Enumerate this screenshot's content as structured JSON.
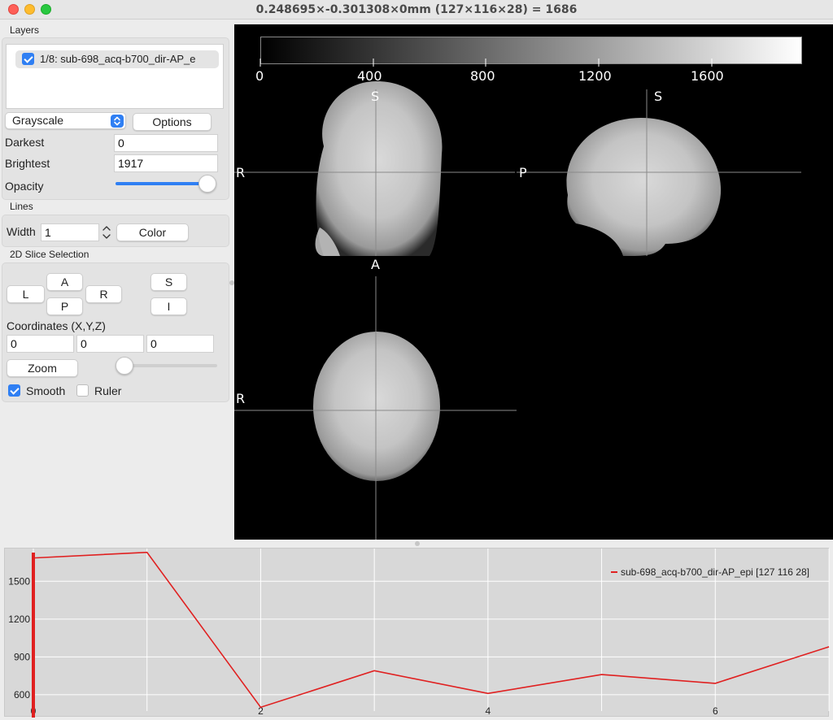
{
  "window": {
    "title": "0.248695×-0.301308×0mm (127×116×28) =  1686"
  },
  "layers": {
    "section_label": "Layers",
    "items": [
      {
        "label": "1/8: sub-698_acq-b700_dir-AP_e",
        "checked": true
      }
    ],
    "colormap": "Grayscale",
    "options_label": "Options",
    "darkest_label": "Darkest",
    "darkest_value": "0",
    "brightest_label": "Brightest",
    "brightest_value": "1917",
    "opacity_label": "Opacity",
    "opacity_level": 1.0
  },
  "lines": {
    "section_label": "Lines",
    "width_label": "Width",
    "width_value": "1",
    "color_label": "Color"
  },
  "slice": {
    "section_label": "2D Slice Selection",
    "buttons": {
      "L": "L",
      "A": "A",
      "R": "R",
      "P": "P",
      "S": "S",
      "I": "I"
    },
    "coordinates_label": "Coordinates (X,Y,Z)",
    "x": "0",
    "y": "0",
    "z": "0",
    "zoom_label": "Zoom",
    "zoom_level": 0.0,
    "smooth_label": "Smooth",
    "smooth_checked": true,
    "ruler_label": "Ruler",
    "ruler_checked": false
  },
  "viewer": {
    "colorbar_ticks": [
      "0",
      "400",
      "800",
      "1200",
      "1600"
    ],
    "orientation_labels": {
      "coronal_top": "S",
      "coronal_left": "R",
      "sagittal_top": "S",
      "sagittal_left": "P",
      "axial_top": "A",
      "axial_left": "R"
    }
  },
  "graph": {
    "legend": "sub-698_acq-b700_dir-AP_epi [127 116 28]",
    "line_color": "#e02020"
  },
  "chart_data": {
    "type": "line",
    "series": [
      {
        "name": "sub-698_acq-b700_dir-AP_epi [127 116 28]",
        "x": [
          0,
          1,
          2,
          3,
          4,
          5,
          6,
          7
        ],
        "values": [
          1685,
          1730,
          500,
          790,
          610,
          760,
          690,
          980
        ]
      }
    ],
    "x_ticks": [
      "0",
      "2",
      "4",
      "6"
    ],
    "y_ticks": [
      "600",
      "900",
      "1200",
      "1500"
    ],
    "xlim": [
      0,
      7
    ],
    "ylim": [
      470,
      1760
    ],
    "grid": true,
    "legend": "top-right"
  }
}
